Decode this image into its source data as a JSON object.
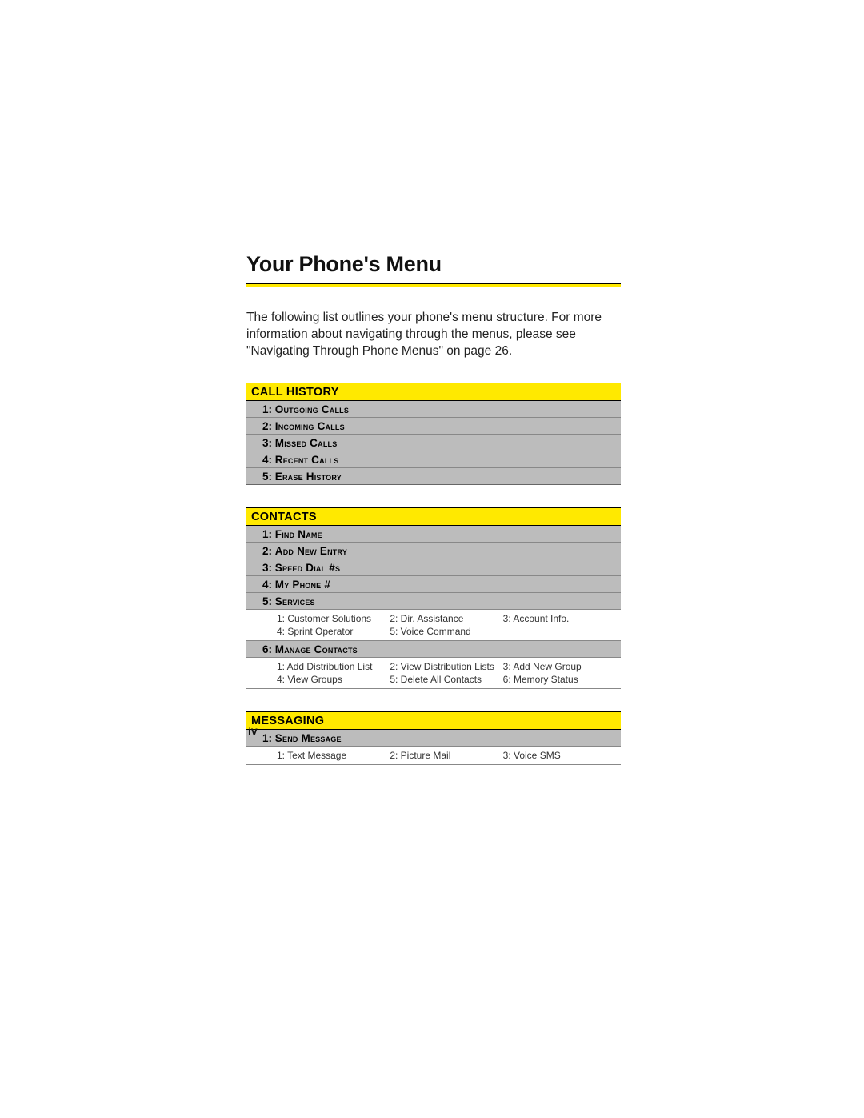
{
  "page": {
    "title": "Your Phone's Menu",
    "intro": "The following list outlines your phone's menu structure. For more information about navigating through the menus, please see \"Navigating Through Phone Menus\" on page 26.",
    "roman_numeral": "iv"
  },
  "sections": {
    "call_history": {
      "header": "CALL HISTORY",
      "items": [
        {
          "num": "1:",
          "label": "Outgoing Calls"
        },
        {
          "num": "2:",
          "label": "Incoming Calls"
        },
        {
          "num": "3:",
          "label": "Missed Calls"
        },
        {
          "num": "4:",
          "label": "Recent Calls"
        },
        {
          "num": "5:",
          "label": "Erase History"
        }
      ]
    },
    "contacts": {
      "header": "CONTACTS",
      "items": [
        {
          "num": "1:",
          "label": "Find Name"
        },
        {
          "num": "2:",
          "label": "Add New Entry"
        },
        {
          "num": "3:",
          "label": "Speed Dial #s"
        },
        {
          "num": "4:",
          "label": "My Phone #"
        },
        {
          "num": "5:",
          "label": "Services"
        },
        {
          "num": "6:",
          "label": "Manage Contacts"
        }
      ],
      "services_sub": [
        "1: Customer Solutions",
        "2: Dir. Assistance",
        "3: Account Info.",
        "4: Sprint Operator",
        "5: Voice Command",
        ""
      ],
      "manage_sub": [
        "1: Add Distribution List",
        "2: View Distribution Lists",
        "3: Add New Group",
        "4: View Groups",
        "5: Delete All Contacts",
        "6: Memory Status"
      ]
    },
    "messaging": {
      "header": "MESSAGING",
      "items": [
        {
          "num": "1:",
          "label": "Send Message"
        }
      ],
      "send_sub": [
        "1: Text Message",
        "2: Picture Mail",
        "3: Voice SMS"
      ]
    }
  }
}
